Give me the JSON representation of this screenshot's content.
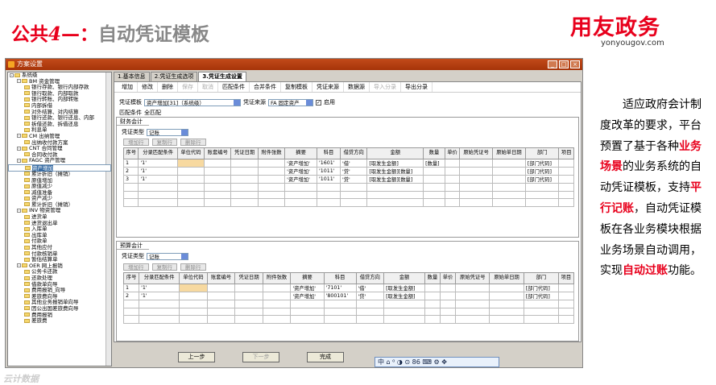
{
  "slide": {
    "title_prefix": "公共",
    "title_num": "4",
    "title_sep": "—：",
    "title_main": "自动凭证模板",
    "logo": "用友政务",
    "logo_url": "yonyougov.com",
    "watermark": "云计数据"
  },
  "window": {
    "title": "方案设置",
    "buttons": [
      "_",
      "□",
      "×"
    ]
  },
  "tree": [
    {
      "t": "系统级",
      "lvl": 0,
      "box": "-"
    },
    {
      "t": "BM 资金管理",
      "lvl": 1,
      "box": "-"
    },
    {
      "t": "银行存款、银行内部存款",
      "lvl": 2
    },
    {
      "t": "银行取款、内部取款",
      "lvl": 2
    },
    {
      "t": "银行转账、内部转账",
      "lvl": 2
    },
    {
      "t": "内部拆借",
      "lvl": 2
    },
    {
      "t": "对外结算、对内结算",
      "lvl": 2
    },
    {
      "t": "银行还款、银行还息、内部",
      "lvl": 2
    },
    {
      "t": "拆借还款、拆借还息",
      "lvl": 2
    },
    {
      "t": "利息单",
      "lvl": 2
    },
    {
      "t": "CM 出纳管理",
      "lvl": 1,
      "box": "-"
    },
    {
      "t": "出纳收付款方案",
      "lvl": 2
    },
    {
      "t": "CNT 合同管理",
      "lvl": 1,
      "box": "-"
    },
    {
      "t": "合同收付款",
      "lvl": 2
    },
    {
      "t": "FAGC 资产管理",
      "lvl": 1,
      "box": "-"
    },
    {
      "t": "资产增加",
      "lvl": 2,
      "sel": true
    },
    {
      "t": "累计折旧（摊销）",
      "lvl": 2
    },
    {
      "t": "原值增加",
      "lvl": 2
    },
    {
      "t": "原值减少",
      "lvl": 2
    },
    {
      "t": "减值准备",
      "lvl": 2
    },
    {
      "t": "资产减少",
      "lvl": 2
    },
    {
      "t": "累计折旧（摊销）",
      "lvl": 2
    },
    {
      "t": "INV 物资管理",
      "lvl": 1,
      "box": "-"
    },
    {
      "t": "进货单",
      "lvl": 2
    },
    {
      "t": "进货退出单",
      "lvl": 2
    },
    {
      "t": "入库单",
      "lvl": 2
    },
    {
      "t": "出库单",
      "lvl": 2
    },
    {
      "t": "付款单",
      "lvl": 2
    },
    {
      "t": "其他应付",
      "lvl": 2
    },
    {
      "t": "付款核销单",
      "lvl": 2
    },
    {
      "t": "暂估结算单",
      "lvl": 2
    },
    {
      "t": "OER 网上报销",
      "lvl": 1,
      "box": "-"
    },
    {
      "t": "公务卡还款",
      "lvl": 2
    },
    {
      "t": "还款处理",
      "lvl": 2
    },
    {
      "t": "借款单向导",
      "lvl": 2
    },
    {
      "t": "费用报销_向导",
      "lvl": 2
    },
    {
      "t": "差旅费向导",
      "lvl": 2
    },
    {
      "t": "其他业务报销单向导",
      "lvl": 2
    },
    {
      "t": "因公出国差旅费向导",
      "lvl": 2
    },
    {
      "t": "费用报销",
      "lvl": 2
    },
    {
      "t": "差旅费",
      "lvl": 2
    }
  ],
  "tabs": [
    "1.基本信息",
    "2.凭证生成选项",
    "3.凭证生成设置"
  ],
  "toolbar": [
    {
      "t": "增加",
      "dis": false
    },
    {
      "t": "修改",
      "dis": false
    },
    {
      "t": "删除",
      "dis": false
    },
    {
      "t": "保存",
      "dis": true
    },
    {
      "t": "取消",
      "dis": true
    },
    {
      "t": "匹配条件",
      "dis": false
    },
    {
      "t": "合并条件",
      "dis": false
    },
    {
      "t": "复制模板",
      "dis": false
    },
    {
      "t": "凭证来源",
      "dis": false
    },
    {
      "t": "数据源",
      "dis": false
    },
    {
      "t": "导入分录",
      "dis": true
    },
    {
      "t": "导出分录",
      "dis": false
    }
  ],
  "form": {
    "template_label": "凭证模板",
    "template_value": "资产增加[31]（系统级）",
    "source_label": "凭证来源",
    "source_value": "FA 固定资产",
    "enable_label": "启用",
    "match_label": "匹配条件",
    "match_value": "全匹配"
  },
  "fin": {
    "label": "财务会计",
    "type_label": "凭证类型",
    "type_value": "记账",
    "buttons": [
      "增加行",
      "复制行",
      "删除行"
    ]
  },
  "budget": {
    "label": "预算会计",
    "type_label": "凭证类型",
    "type_value": "记账",
    "buttons": [
      "增加行",
      "复制行",
      "删除行"
    ]
  },
  "columns": [
    "序号",
    "分录匹配条件",
    "单位代码",
    "账套编号",
    "凭证日期",
    "附件张数",
    "摘要",
    "科目",
    "借贷方向",
    "金额",
    "数量",
    "单价",
    "原始凭证号",
    "原始单日期",
    "部门",
    "项目"
  ],
  "fin_rows": [
    [
      "1",
      "'1'",
      "",
      "",
      "",
      "",
      "'资产增加'",
      "'1601'",
      "'借'",
      "[取发生金额]",
      "[数量]",
      "",
      "",
      "",
      "[部门代码]",
      ""
    ],
    [
      "2",
      "'1'",
      "",
      "",
      "",
      "",
      "'资产增加'",
      "'1011'",
      "'贷'",
      "[取发生金额][数量]",
      "",
      "",
      "",
      "",
      "[部门代码]",
      ""
    ],
    [
      "3",
      "'1'",
      "",
      "",
      "",
      "",
      "'资产增加'",
      "'1011'",
      "'贷'",
      "[取发生金额][数量]",
      "",
      "",
      "",
      "",
      "[部门代码]",
      ""
    ]
  ],
  "budget_rows": [
    [
      "1",
      "'1'",
      "",
      "",
      "",
      "",
      "'资产增加'",
      "'7101'",
      "'借'",
      "[取发生金额]",
      "",
      "",
      "",
      "",
      "[部门代码]",
      ""
    ],
    [
      "2",
      "'1'",
      "",
      "",
      "",
      "",
      "'资产增加'",
      "'800101'",
      "'贷'",
      "[取发生金额]",
      "",
      "",
      "",
      "",
      "[部门代码]",
      ""
    ]
  ],
  "footer_buttons": [
    {
      "t": "上一步",
      "dis": false
    },
    {
      "t": "下一步",
      "dis": true
    },
    {
      "t": "完成",
      "dis": false
    }
  ],
  "ime": "中 ⌂ ⁰ ◑ ⊙ 86 ⌨ ⚙ ✥",
  "description": {
    "p1": "适应政府会计制度改革的要求，平台预置了基于各种",
    "r1": "业务场景",
    "p2": "的业务系统的自动凭证模板，支持",
    "r2": "平行记账",
    "p3": "，自动凭证模板在各业务模块根据业务场景自动调用，实现",
    "r3": "自动过账",
    "p4": "功能。"
  }
}
